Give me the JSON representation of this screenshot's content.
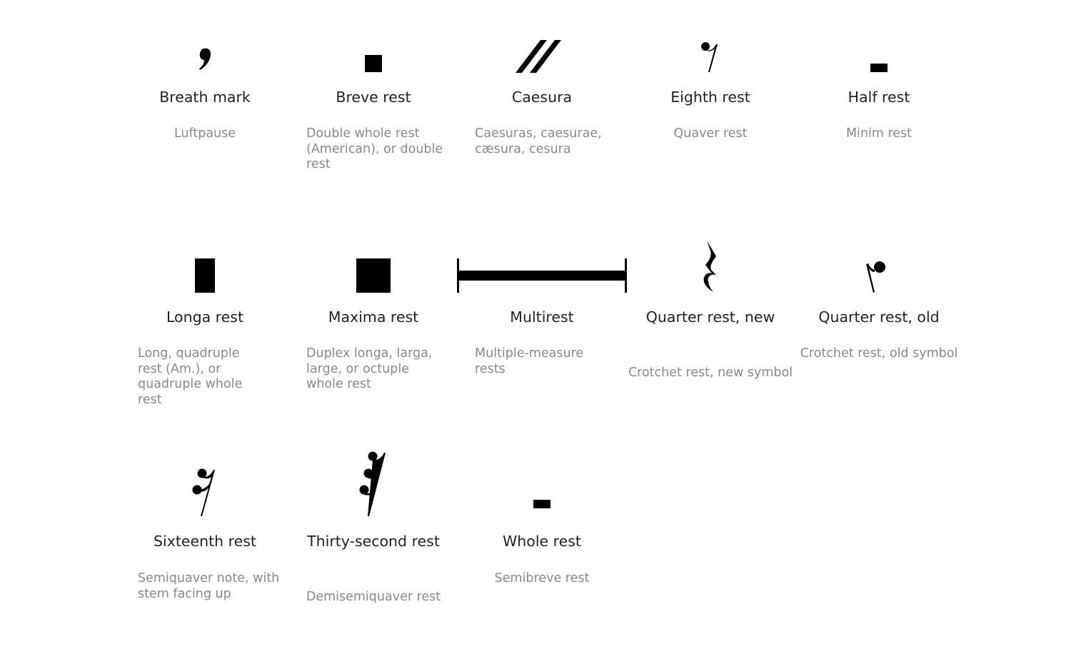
{
  "symbols": [
    {
      "icon": "breath-mark-icon",
      "title": "Breath mark",
      "description": "Luftpause"
    },
    {
      "icon": "breve-rest-icon",
      "title": "Breve rest",
      "description": "Double whole rest (American), or double rest"
    },
    {
      "icon": "caesura-icon",
      "title": "Caesura",
      "description": "Caesuras, caesurae, cæsura, cesura"
    },
    {
      "icon": "eighth-rest-icon",
      "title": "Eighth rest",
      "description": "Quaver rest"
    },
    {
      "icon": "half-rest-icon",
      "title": "Half rest",
      "description": "Minim rest"
    },
    {
      "icon": "longa-rest-icon",
      "title": "Longa rest",
      "description": "Long, quadruple rest (Am.), or quadruple whole rest"
    },
    {
      "icon": "maxima-rest-icon",
      "title": "Maxima rest",
      "description": "Duplex longa, larga, large, or octuple whole rest"
    },
    {
      "icon": "multirest-icon",
      "title": "Multirest",
      "description": "Multiple-measure rests"
    },
    {
      "icon": "quarter-rest-new-icon",
      "title": "Quarter rest, new",
      "description": "Crotchet rest, new symbol"
    },
    {
      "icon": "quarter-rest-old-icon",
      "title": "Quarter rest, old",
      "description": "Crotchet rest, old symbol"
    },
    {
      "icon": "sixteenth-rest-icon",
      "title": "Sixteenth rest",
      "description": "Semiquaver note, with stem facing up"
    },
    {
      "icon": "thirty-second-rest-icon",
      "title": "Thirty-second rest",
      "description": "Demisemiquaver rest"
    },
    {
      "icon": "whole-rest-icon",
      "title": "Whole rest",
      "description": "Semibreve rest"
    }
  ]
}
